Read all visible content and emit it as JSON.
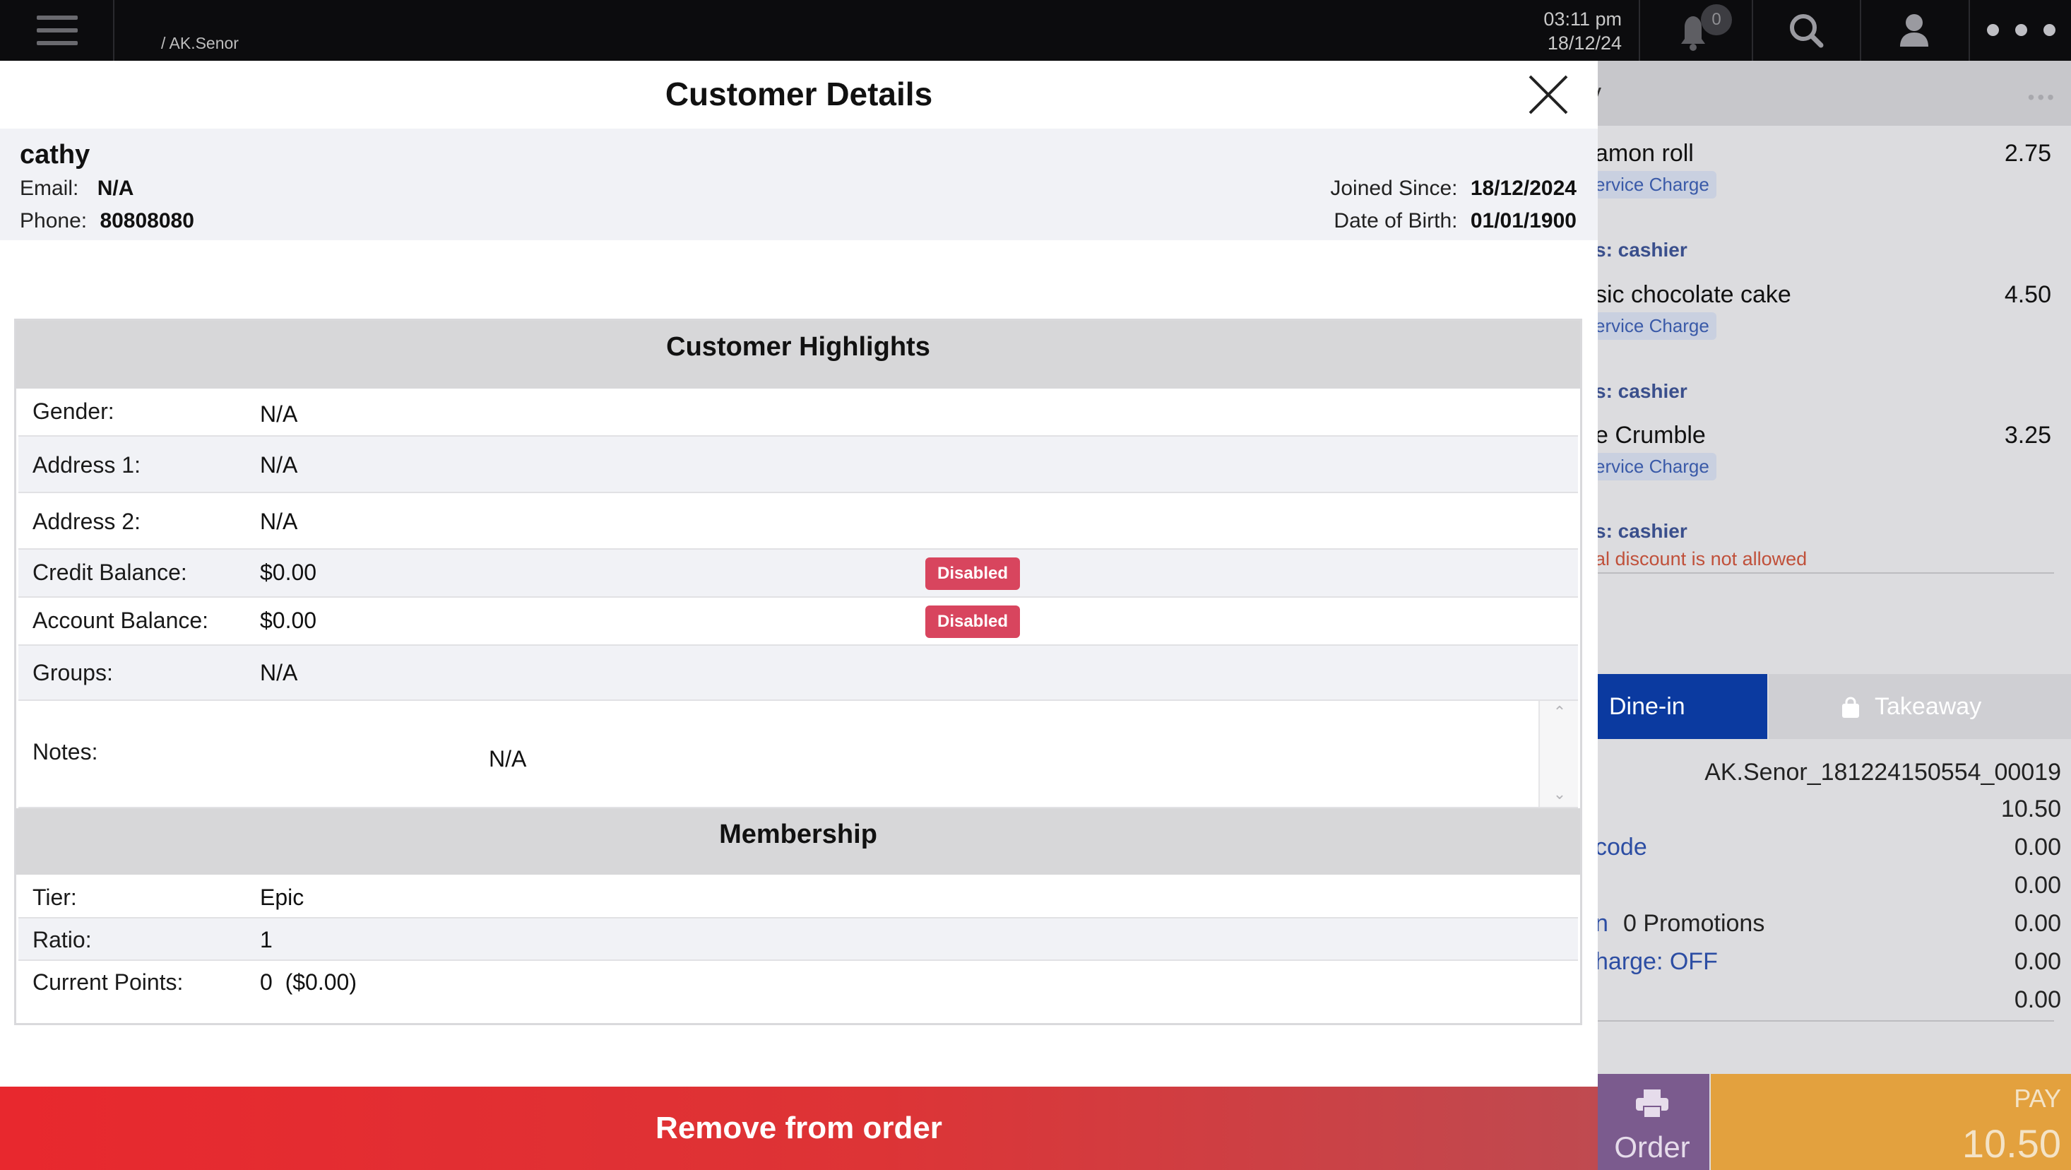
{
  "topbar": {
    "breadcrumb": "/ AK.Senor",
    "time": "03:11 pm",
    "date": "18/12/24",
    "notification_count": "0"
  },
  "order_panel": {
    "title": "y",
    "items": [
      {
        "name": "amon roll",
        "price": "2.75",
        "tag": "ervice Charge",
        "staff": "s: cashier"
      },
      {
        "name": "sic chocolate cake",
        "price": "4.50",
        "tag": "ervice Charge",
        "staff": "s: cashier"
      },
      {
        "name": "e Crumble",
        "price": "3.25",
        "tag": "ervice Charge",
        "staff": "s: cashier"
      }
    ],
    "warning": "al discount is not allowed",
    "dine_in_label": "Dine-in",
    "takeaway_label": "Takeaway",
    "summary": {
      "order_id": "AK.Senor_181224150554_00019",
      "subtotal": "10.50",
      "code_label": "code",
      "code_value": "0.00",
      "line_value": "0.00",
      "promotions_prefix": "n",
      "promotions_label": "0 Promotions",
      "promotions_value": "0.00",
      "charge_label": "harge: OFF",
      "charge_value": "0.00",
      "last_value": "0.00"
    },
    "order_button": "Order",
    "pay_label": "PAY",
    "pay_amount": "10.50"
  },
  "modal": {
    "title": "Customer Details",
    "customer": {
      "name": "cathy",
      "email_label": "Email:",
      "email": "N/A",
      "phone_label": "Phone:",
      "phone": "80808080",
      "joined_label": "Joined Since:",
      "joined": "18/12/2024",
      "dob_label": "Date of Birth:",
      "dob": "01/01/1900"
    },
    "highlights": {
      "title": "Customer Highlights",
      "rows": [
        {
          "label": "Gender:",
          "value": "N/A"
        },
        {
          "label": "Address 1:",
          "value": "N/A"
        },
        {
          "label": "Address 2:",
          "value": "N/A"
        },
        {
          "label": "Credit Balance:",
          "value": "$0.00",
          "badge": "Disabled"
        },
        {
          "label": "Account Balance:",
          "value": "$0.00",
          "badge": "Disabled"
        },
        {
          "label": "Groups:",
          "value": "N/A"
        },
        {
          "label": "Notes:",
          "value": "N/A"
        }
      ]
    },
    "membership": {
      "title": "Membership",
      "rows": [
        {
          "label": "Tier:",
          "value": "Epic"
        },
        {
          "label": "Ratio:",
          "value": "1"
        },
        {
          "label": "Current Points:",
          "value": "0  ($0.00)"
        }
      ]
    },
    "remove_button": "Remove from order"
  },
  "colors": {
    "topbar_bg": "#0c0c0e",
    "accent_blue": "#0b3aa0",
    "badge_red": "#d8455e",
    "remove_red": "#e8282e",
    "pay_orange": "#e3a13e"
  },
  "icons": [
    "hamburger-menu-icon",
    "bell-icon",
    "search-icon",
    "user-icon",
    "more-dots-icon",
    "close-icon",
    "shopping-bag-icon",
    "printer-icon",
    "chevron-up-icon",
    "chevron-down-icon"
  ]
}
